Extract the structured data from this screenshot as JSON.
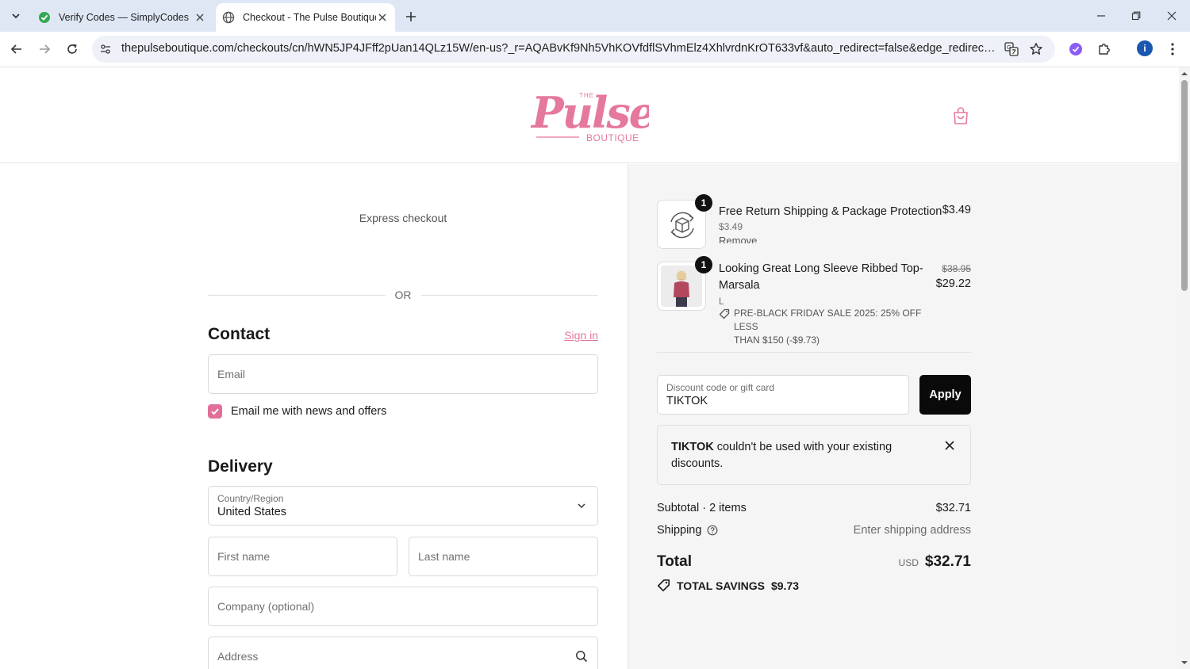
{
  "browser": {
    "tabs": [
      {
        "title": "Verify Codes — SimplyCodes",
        "icon": "simplycodes-favicon"
      },
      {
        "title": "Checkout - The Pulse Boutique",
        "icon": "globe-favicon"
      }
    ],
    "url": "thepulseboutique.com/checkouts/cn/hWN5JP4JFff2pUan14QLz15W/en-us?_r=AQABvKf9Nh5VhKOVfdflSVhmElz4XhlvrdnKrOT633vf&auto_redirect=false&edge_redirect=true&skip_s...",
    "profile_initial": "i",
    "colors": {
      "tabbar": "#dfe7f5",
      "omnibox": "#eef1f7",
      "profile": "#1a57b0"
    }
  },
  "header": {
    "logo": {
      "small": "THE",
      "script": "Pulse",
      "sub": "BOUTIQUE",
      "color": "#e5789e"
    }
  },
  "checkout": {
    "express_label": "Express checkout",
    "or_label": "OR",
    "contact": {
      "heading": "Contact",
      "sign_in": "Sign in",
      "email_placeholder": "Email",
      "newsletter_label": "Email me with news and offers",
      "newsletter_checked": true
    },
    "delivery": {
      "heading": "Delivery",
      "country_label": "Country/Region",
      "country_value": "United States",
      "first_name_placeholder": "First name",
      "last_name_placeholder": "Last name",
      "company_placeholder": "Company (optional)",
      "address_placeholder": "Address"
    }
  },
  "summary": {
    "items": [
      {
        "qty": "1",
        "name": "Free Return Shipping & Package Protection",
        "unit_price": "$3.49",
        "remove": "Remove",
        "price": "$3.49"
      },
      {
        "qty": "1",
        "name_line1": "Looking Great Long Sleeve Ribbed Top-",
        "name_line2": "Marsala",
        "variant": "L",
        "discount_line1": "PRE-BLACK FRIDAY SALE 2025: 25% OFF LESS",
        "discount_line2": "THAN $150 (-$9.73)",
        "original_price": "$38.95",
        "price": "$29.22"
      }
    ],
    "discount": {
      "label": "Discount code or gift card",
      "value": "TIKTOK",
      "apply_label": "Apply"
    },
    "error": {
      "code": "TIKTOK",
      "message": " couldn't be used with your existing discounts."
    },
    "subtotal_label": "Subtotal · 2 items",
    "subtotal_value": "$32.71",
    "shipping_label": "Shipping",
    "shipping_value": "Enter shipping address",
    "total_label": "Total",
    "total_currency": "USD",
    "total_value": "$32.71",
    "savings_label": "TOTAL SAVINGS",
    "savings_value": "$9.73",
    "accent": "#e0709a"
  }
}
